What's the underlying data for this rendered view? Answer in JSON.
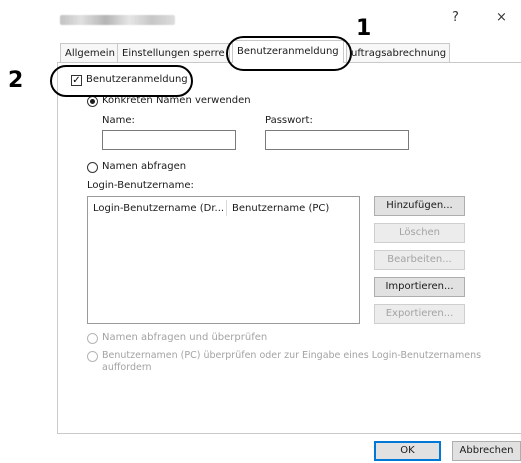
{
  "window": {
    "help_label": "?",
    "close_label": "×"
  },
  "tabs": [
    {
      "label": "Allgemein",
      "active": false
    },
    {
      "label": "Einstellungen sperre",
      "active": false
    },
    {
      "label": "Benutzeranmeldung",
      "active": true
    },
    {
      "label": "uftragsabrechnung",
      "active": false
    }
  ],
  "callouts": [
    {
      "number": "1",
      "target": "Benutzeranmeldung tab"
    },
    {
      "number": "2",
      "target": "Benutzeranmeldung checkbox"
    }
  ],
  "user_login": {
    "checkbox_label": "Benutzeranmeldung",
    "checkbox_checked": true,
    "radio_specific_label": "Konkreten Namen verwenden",
    "radio_specific_selected": true,
    "name_label": "Name:",
    "name_value": "",
    "password_label": "Passwort:",
    "password_value": "",
    "radio_prompt_label": "Namen abfragen",
    "login_user_label": "Login-Benutzername:",
    "list_columns": [
      "Login-Benutzername (Dr...",
      "Benutzername (PC)"
    ],
    "buttons": {
      "add": "Hinzufügen...",
      "delete": "Löschen",
      "edit": "Bearbeiten...",
      "import": "Importieren...",
      "export": "Exportieren..."
    },
    "radio_prompt_verify_label": "Namen abfragen und überprüfen",
    "radio_verify_pc_label_line1": "Benutzernamen (PC) überprüfen oder zur Eingabe eines Login-Benutzernamens",
    "radio_verify_pc_label_line2": "auffordern"
  },
  "footer": {
    "ok_label": "OK",
    "cancel_label": "Abbrechen"
  }
}
